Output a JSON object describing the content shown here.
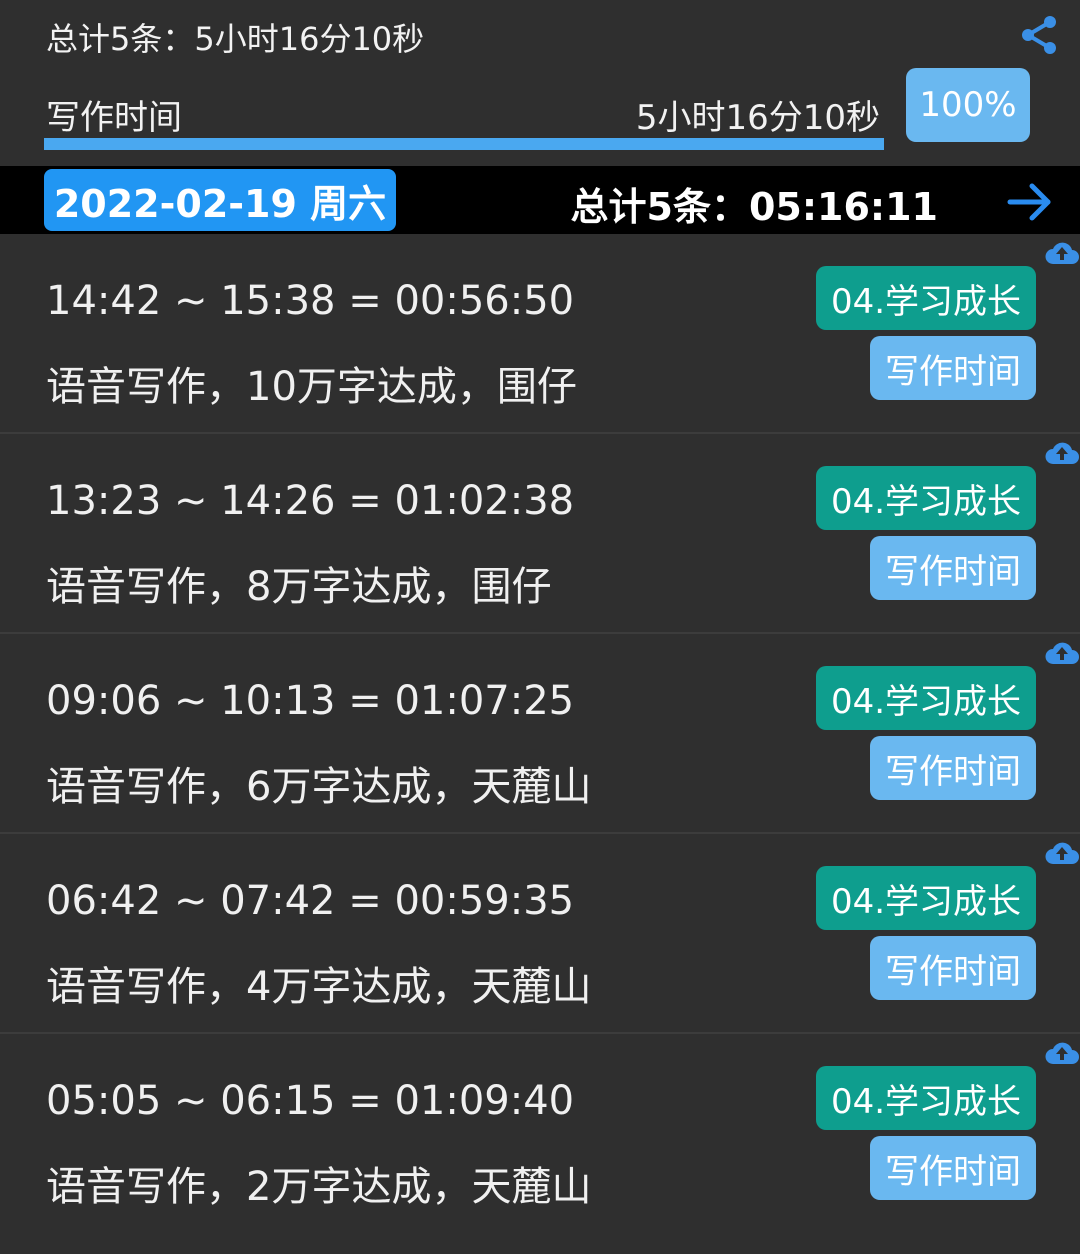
{
  "summary": {
    "total_text": "总计5条：5小时16分10秒",
    "category_label": "写作时间",
    "category_duration": "5小时16分10秒",
    "percent_text": "100%",
    "progress": 1.0
  },
  "date_bar": {
    "date_label": "2022-02-19 周六",
    "total_text": "总计5条：05:16:11"
  },
  "icons": {
    "share": "share-icon",
    "next": "arrow-right-icon",
    "upload": "cloud-upload-icon"
  },
  "colors": {
    "accent": "#2196f3",
    "tag_teal": "#0e9e8e",
    "tag_blue": "#6ab8f0"
  },
  "entries": [
    {
      "time_range": "14:42 ~ 15:38 = 00:56:50",
      "note": "语音写作，10万字达成，围仔",
      "category": "04.学习成长",
      "subcategory": "写作时间"
    },
    {
      "time_range": "13:23 ~ 14:26 = 01:02:38",
      "note": "语音写作，8万字达成，围仔",
      "category": "04.学习成长",
      "subcategory": "写作时间"
    },
    {
      "time_range": "09:06 ~ 10:13 = 01:07:25",
      "note": "语音写作，6万字达成，天麓山",
      "category": "04.学习成长",
      "subcategory": "写作时间"
    },
    {
      "time_range": "06:42 ~ 07:42 = 00:59:35",
      "note": "语音写作，4万字达成，天麓山",
      "category": "04.学习成长",
      "subcategory": "写作时间"
    },
    {
      "time_range": "05:05 ~ 06:15 = 01:09:40",
      "note": "语音写作，2万字达成，天麓山",
      "category": "04.学习成长",
      "subcategory": "写作时间"
    }
  ]
}
